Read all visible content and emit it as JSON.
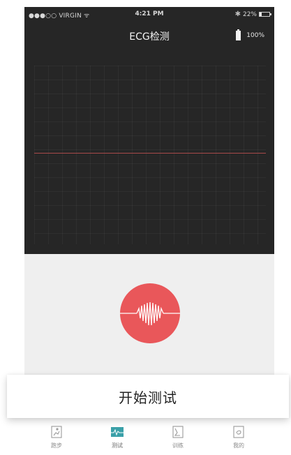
{
  "status_bar": {
    "carrier": "●●●○○ VIRGIN ᯤ",
    "time": "4:21 PM",
    "bluetooth": "✱",
    "battery_percent": "22%",
    "battery_level": 0.22
  },
  "header": {
    "title": "ECG检测",
    "device_battery": "100%"
  },
  "ecg": {
    "signal_level": "flat"
  },
  "start_button": {
    "label": "开始测试"
  },
  "tabs": [
    {
      "label": "跑步",
      "icon": "running-icon",
      "active": false
    },
    {
      "label": "测试",
      "icon": "ecg-wave-icon",
      "active": true
    },
    {
      "label": "训练",
      "icon": "training-icon",
      "active": false
    },
    {
      "label": "我的",
      "icon": "profile-icon",
      "active": false
    }
  ],
  "colors": {
    "heart_button": "#e9575a",
    "ecg_line": "#a94a4a",
    "active_tab": "#3aa0a8",
    "screen_background": "#262626"
  }
}
